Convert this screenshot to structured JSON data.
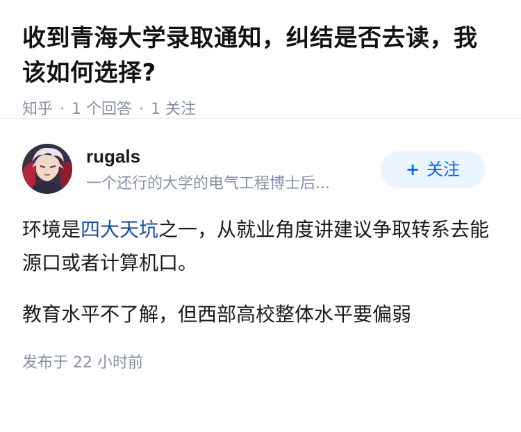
{
  "question": {
    "title": "收到青海大学录取通知，纠结是否去读，我该如何选择?",
    "source": "知乎",
    "answer_count": "1 个回答",
    "follow_count": "1 关注"
  },
  "answer": {
    "author": {
      "name": "rugals",
      "bio": "一个还行的大学的电气工程博士后...",
      "follow_label": "关注"
    },
    "paragraph1": {
      "before": "环境是",
      "link": "四大天坑",
      "after": "之一，从就业角度讲建议争取转系去能源口或者计算机口。"
    },
    "paragraph2": "教育水平不了解，但西部高校整体水平要偏弱",
    "publish_time": "发布于  22 小时前"
  },
  "colors": {
    "link": "#175199",
    "accent": "#0066ff",
    "meta": "#8590a6",
    "follow_bg": "#ebf5ff"
  }
}
